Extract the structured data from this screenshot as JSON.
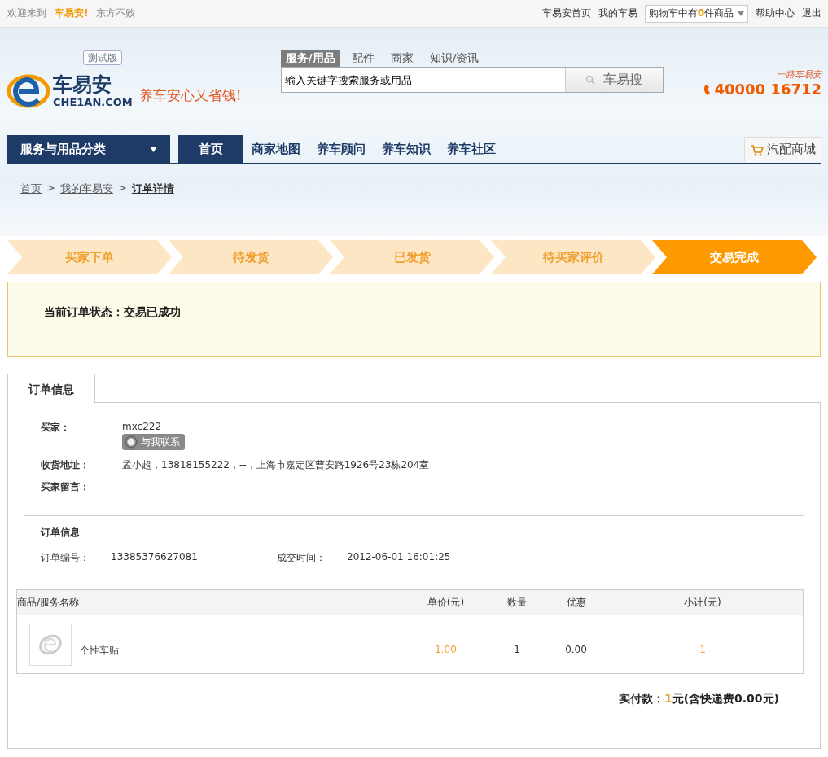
{
  "top_bar": {
    "welcome": "欢迎来到",
    "brand": "车易安!",
    "slogan": "东方不败",
    "links": [
      "车易安首页",
      "我的车易"
    ],
    "cart": {
      "prefix": "购物车中有",
      "count": "0",
      "suffix": "件商品"
    },
    "links_right": [
      "帮助中心",
      "退出"
    ]
  },
  "header": {
    "logo_text": "车易安",
    "logo_domain": "CHE1AN.COM",
    "badge": "测试版",
    "tagline": "养车安心又省钱!",
    "search_tabs": [
      {
        "label": "服务/用品",
        "selected": true
      },
      {
        "label": "配件",
        "selected": false
      },
      {
        "label": "商家",
        "selected": false
      },
      {
        "label": "知识/资讯",
        "selected": false
      }
    ],
    "search": {
      "placeholder": "输入关键字搜索服务或用品"
    },
    "search_button": "车易搜",
    "hotline_caption": "一路车易安",
    "hotline": "40000 16712"
  },
  "nav": {
    "category": "服务与用品分类",
    "items": [
      {
        "label": "首页",
        "selected": true
      },
      {
        "label": "商家地图",
        "selected": false
      },
      {
        "label": "养车顾问",
        "selected": false
      },
      {
        "label": "养车知识",
        "selected": false
      },
      {
        "label": "养车社区",
        "selected": false
      }
    ],
    "mall_button": "汽配商城"
  },
  "breadcrumb": {
    "items": [
      "首页",
      "我的车易安",
      "订单详情"
    ],
    "separators": [
      ">",
      ">"
    ]
  },
  "steps": [
    {
      "label": "买家下单",
      "selected": false
    },
    {
      "label": "待发货",
      "selected": false
    },
    {
      "label": "已发货",
      "selected": false
    },
    {
      "label": "待买家评价",
      "selected": false
    },
    {
      "label": "交易完成",
      "selected": true
    }
  ],
  "status": {
    "label": "当前订单状态：",
    "value": "交易已成功"
  },
  "tabs": [
    {
      "label": "订单信息",
      "selected": true
    }
  ],
  "buyer": {
    "buyer_label": "买家：",
    "buyer_value": "mxc222",
    "contact_button": "与我联系",
    "address_label": "收货地址：",
    "address_value": "孟小超，13818155222，--，上海市嘉定区曹安路1926号23栋204室",
    "message_label": "买家留言："
  },
  "order": {
    "heading": "订单信息",
    "number_label": "订单编号：",
    "number_value": "13385376627081",
    "time_label": "成交时间：",
    "time_value": "2012-06-01 16:01:25"
  },
  "table": {
    "columns": [
      "商品/服务名称",
      "单价(元)",
      "数量",
      "优惠",
      "小计(元)"
    ],
    "rows": [
      {
        "name": "个性车贴",
        "price": "1.00",
        "quantity": "1",
        "discount": "0.00",
        "subtotal": "1"
      }
    ]
  },
  "total": {
    "label": "实付款：",
    "amount": "1",
    "suffix": "元(含快递费0.00元)"
  }
}
